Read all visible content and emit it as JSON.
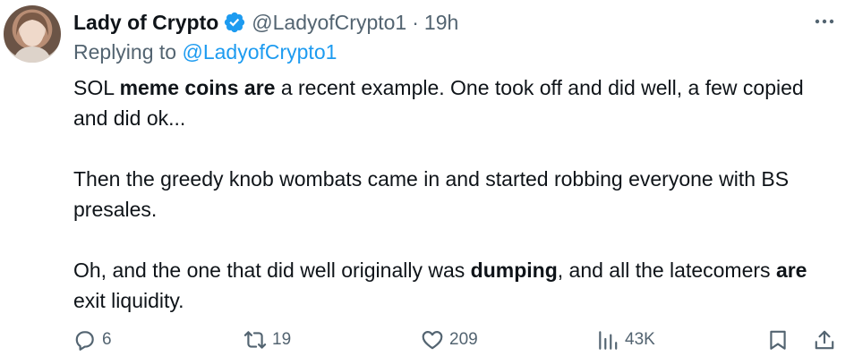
{
  "tweet": {
    "author": {
      "display_name": "Lady of Crypto",
      "handle": "@LadyofCrypto1",
      "separator": "·",
      "time": "19h"
    },
    "reply_prefix": "Replying to",
    "reply_to": "@LadyofCrypto1",
    "paragraph1": {
      "t1": "SOL ",
      "b1": "meme coins are",
      "t2": " a recent example. One took off and did well, a few copied and did ok..."
    },
    "paragraph2": "Then the greedy knob wombats came in and started robbing everyone with BS presales.",
    "paragraph3": {
      "t1": "Oh, and the one that did well originally was ",
      "b1": "dumping",
      "t2": ", and all the latecomers ",
      "b2": "are",
      "t3": " exit liquidity."
    },
    "stats": {
      "replies": "6",
      "reposts": "19",
      "likes": "209",
      "views": "43K"
    }
  },
  "colors": {
    "accent": "#1d9bf0",
    "muted": "#536471",
    "text": "#0f1419"
  },
  "icons": [
    "verified-badge-icon",
    "more-icon",
    "reply-icon",
    "repost-icon",
    "like-icon",
    "views-icon",
    "bookmark-icon",
    "share-icon"
  ]
}
